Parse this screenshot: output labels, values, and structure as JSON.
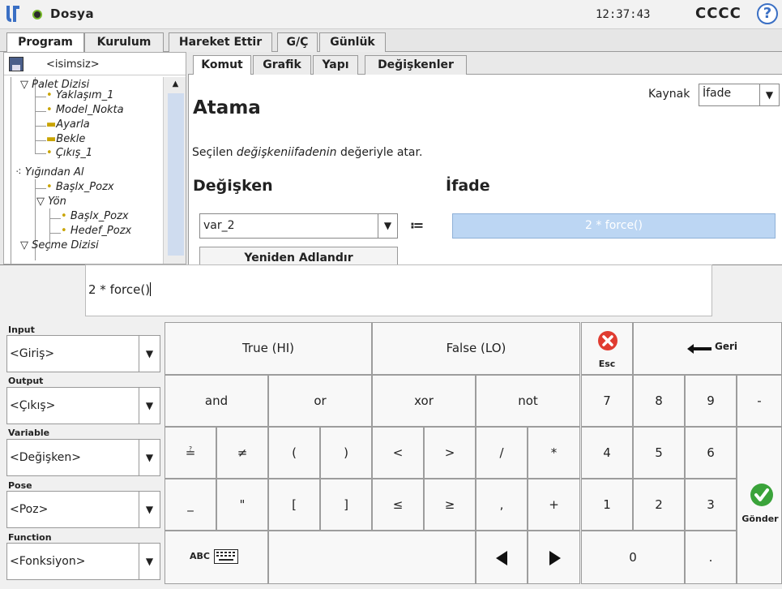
{
  "app": {
    "title": "Dosya",
    "clock": "12:37:43",
    "robot_name": "CCCC"
  },
  "colors": {
    "accent": "#3a6fc4",
    "expr_bg": "#bcd6f3",
    "esc_red": "#e03c31",
    "ok_green": "#3aa33a"
  },
  "main_tabs": [
    "Program",
    "Kurulum",
    "Hareket Ettir",
    "G/Ç",
    "Günlük"
  ],
  "left": {
    "program_name": "<isimsiz>",
    "tree": [
      "Palet Dizisi",
      "Yaklaşım_1",
      "Model_Nokta",
      "Ayarla",
      "Bekle",
      "Çıkış_1",
      "Yığından Al",
      "Başlx_Pozx",
      "Yön",
      "Başlx_Pozx",
      "Hedef_Pozx",
      "Seçme Dizisi"
    ]
  },
  "sub_tabs": [
    "Komut",
    "Grafik",
    "Yapı",
    "Değişkenler"
  ],
  "command": {
    "kaynak_label": "Kaynak",
    "kaynak_value": "İfade",
    "title": "Atama",
    "desc_1": "Seçilen ",
    "desc_2": "değişkeniifadenin",
    "desc_3": " değeriyle atar.",
    "var_heading": "Değişken",
    "expr_heading": "İfade",
    "var_value": "var_2",
    "assign_symbol": "≔",
    "expr_value": "2 * force()",
    "rename_button": "Yeniden Adlandır"
  },
  "keyboard": {
    "input_text": "2 * force()",
    "selectors": [
      {
        "label": "Input",
        "value": "<Giriş>"
      },
      {
        "label": "Output",
        "value": "<Çıkış>"
      },
      {
        "label": "Variable",
        "value": "<Değişken>"
      },
      {
        "label": "Pose",
        "value": "<Poz>"
      },
      {
        "label": "Function",
        "value": "<Fonksiyon>"
      }
    ],
    "true_key": "True (HI)",
    "false_key": "False (LO)",
    "esc_label": "Esc",
    "back_label": "Geri",
    "and_key": "and",
    "or_key": "or",
    "xor_key": "xor",
    "not_key": "not",
    "row3_symbols": [
      "≟",
      "≠",
      "(",
      ")",
      "<",
      ">",
      "/",
      "*"
    ],
    "row4_symbols": [
      "_",
      "\"",
      "[",
      "]",
      "≤",
      "≥",
      ",",
      "+"
    ],
    "numpad": [
      "7",
      "8",
      "9",
      "-",
      "4",
      "5",
      "6",
      "1",
      "2",
      "3",
      "0",
      "."
    ],
    "abc_label": "ABC",
    "submit_label": "Gönder"
  }
}
